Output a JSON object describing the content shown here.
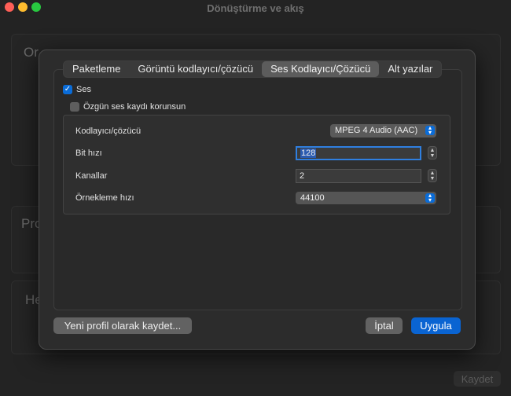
{
  "window": {
    "title": "Dönüştürme ve akış"
  },
  "background": {
    "section1": "Or",
    "section2": "Pro",
    "section3": "He",
    "save_label": "Kaydet"
  },
  "tabs": [
    {
      "label": "Paketleme",
      "active": false
    },
    {
      "label": "Görüntü kodlayıcı/çözücü",
      "active": false
    },
    {
      "label": "Ses Kodlayıcı/Çözücü",
      "active": true
    },
    {
      "label": "Alt yazılar",
      "active": false
    }
  ],
  "audio": {
    "enable_label": "Ses",
    "enable_checked": true,
    "keep_original_label": "Özgün ses kaydı korunsun",
    "keep_original_checked": false,
    "codec_label": "Kodlayıcı/çözücü",
    "codec_value": "MPEG 4 Audio (AAC)",
    "bitrate_label": "Bit hızı",
    "bitrate_value": "128",
    "channels_label": "Kanallar",
    "channels_value": "2",
    "samplerate_label": "Örnekleme hızı",
    "samplerate_value": "44100"
  },
  "buttons": {
    "save_profile": "Yeni profil olarak kaydet...",
    "cancel": "İptal",
    "apply": "Uygula"
  },
  "colors": {
    "accent": "#0a64d2",
    "close": "#fe5f57",
    "minimize": "#febc2e",
    "zoom": "#28c840"
  }
}
